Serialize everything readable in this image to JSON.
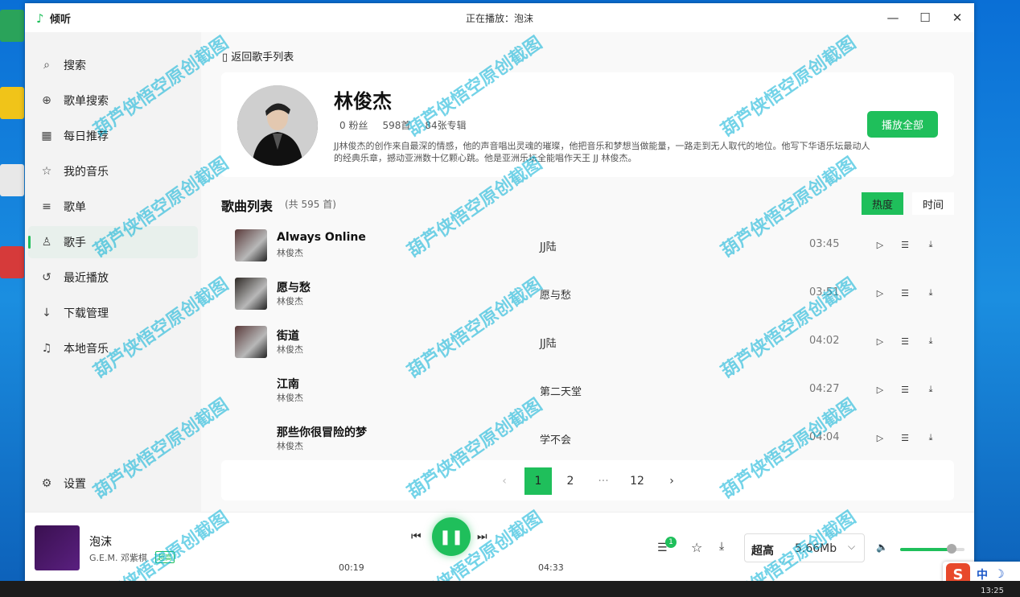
{
  "window": {
    "logo_icon": "♪",
    "app_name": "倾听",
    "now_playing": "正在播放：泡沫"
  },
  "sidebar": {
    "items": [
      {
        "label": "搜索",
        "icon": "⌕"
      },
      {
        "label": "歌单搜索",
        "icon": "⊕"
      },
      {
        "label": "每日推荐",
        "icon": "▦"
      },
      {
        "label": "我的音乐",
        "icon": "☆"
      },
      {
        "label": "歌单",
        "icon": "≡"
      },
      {
        "label": "歌手",
        "icon": "♙"
      },
      {
        "label": "最近播放",
        "icon": "↺"
      },
      {
        "label": "下载管理",
        "icon": "↓"
      },
      {
        "label": "本地音乐",
        "icon": "♫"
      }
    ],
    "settings": {
      "label": "设置",
      "icon": "⚙"
    }
  },
  "artist": {
    "back_label": "返回歌手列表",
    "name": "林俊杰",
    "fans": "0 粉丝",
    "songs": "598首",
    "albums": "84张专辑",
    "bio": "JJ林俊杰的创作来自最深的情感，他的声音唱出灵魂的璀璨，他把音乐和梦想当做能量，一路走到无人取代的地位。他写下华语乐坛最动人的经典乐章，撼动亚洲数十亿颗心跳。他是亚洲乐坛全能唱作天王 JJ 林俊杰。",
    "play_all": "播放全部"
  },
  "songlist": {
    "title": "歌曲列表",
    "count": "(共 595 首)",
    "sort_hot": "热度",
    "sort_time": "时间",
    "rows": [
      {
        "name": "Always Online",
        "artist": "林俊杰",
        "album": "JJ陆",
        "duration": "03:45",
        "cover": true
      },
      {
        "name": "愿与愁",
        "artist": "林俊杰",
        "album": "愿与愁",
        "duration": "03:51",
        "cover": true
      },
      {
        "name": "街道",
        "artist": "林俊杰",
        "album": "JJ陆",
        "duration": "04:02",
        "cover": true
      },
      {
        "name": "江南",
        "artist": "林俊杰",
        "album": "第二天堂",
        "duration": "04:27",
        "cover": false
      },
      {
        "name": "那些你很冒险的梦",
        "artist": "林俊杰",
        "album": "学不会",
        "duration": "04:04",
        "cover": false
      }
    ]
  },
  "pager": {
    "prev": "‹",
    "next": "›",
    "pages": [
      "1",
      "2",
      "···",
      "12"
    ],
    "current": "1"
  },
  "player": {
    "title": "泡沫",
    "artist": "G.E.M. 邓紫棋",
    "quality_badge": "超高",
    "current_time": "00:19",
    "total_time": "04:33",
    "playlist_count": "1",
    "quality_label": "超高",
    "quality_size": "5.66Mb",
    "volume": 0.8
  },
  "colors": {
    "accent": "#1fbf5b"
  },
  "watermark": "葫芦侠悟空原创截图",
  "taskbar_time": "13:25"
}
